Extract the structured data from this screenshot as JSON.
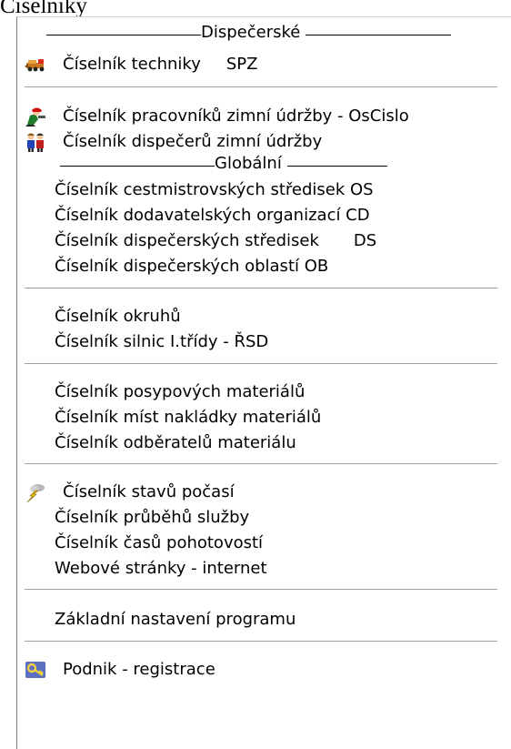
{
  "title": "Číselníky",
  "sections": {
    "dispecerske": "Dispečerské",
    "globalni": "Globální"
  },
  "items": {
    "technika": "Číselník techniky",
    "technika_suffix": "SPZ",
    "pracovnici": "Číselník pracovníků zimní údržby - OsCislo",
    "dispeceri": "Číselník dispečerů zimní údržby",
    "cestmistrovska": "Číselník cestmistrovských středisek OS",
    "dodavatelske": "Číselník dodavatelských organizací CD",
    "dispecerska_strediska": "Číselník dispečerských středisek",
    "dispecerska_strediska_suffix": "DS",
    "dispecerske_oblasti": "Číselník dispečerských oblastí OB",
    "okruhy": "Číselník okruhů",
    "silnice": "Číselník silnic I.třídy - ŘSD",
    "posypove": "Číselník posypových materiálů",
    "mista_nakladky": "Číselník míst nakládky materiálů",
    "odberatele": "Číselník odběratelů materiálu",
    "pocasi": "Číselník stavů počasí",
    "prubehy": "Číselník průběhů služby",
    "pohotovosti": "Číselník časů pohotovostí",
    "web": "Webové stránky - internet",
    "nastaveni": "Základní nastavení programu",
    "registrace": "Podnik - registrace"
  },
  "icons": {
    "technika": "truck-icon",
    "pracovnici": "worker-icon",
    "dispeceri": "people-icon",
    "pocasi": "weather-lightning-icon",
    "registrace": "keys-icon"
  },
  "colors": {
    "separator": "#a0a0a0",
    "menu_background": "#ffffff"
  }
}
